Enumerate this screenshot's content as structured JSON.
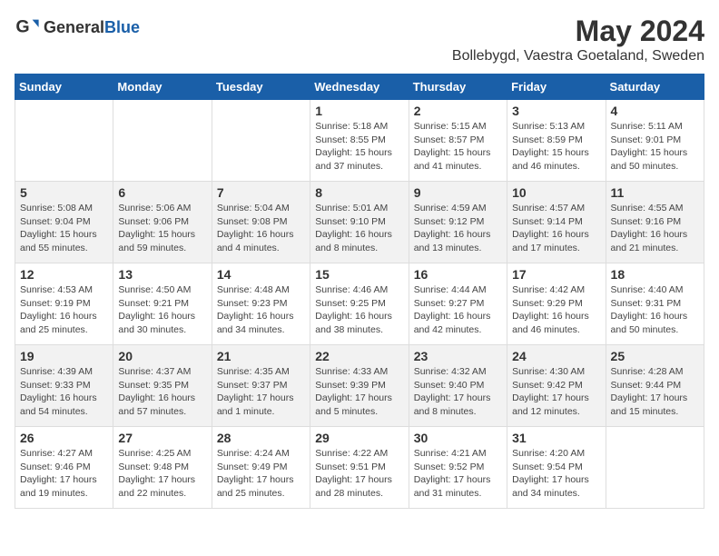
{
  "header": {
    "logo_general": "General",
    "logo_blue": "Blue",
    "main_title": "May 2024",
    "sub_title": "Bollebygd, Vaestra Goetaland, Sweden"
  },
  "calendar": {
    "weekdays": [
      "Sunday",
      "Monday",
      "Tuesday",
      "Wednesday",
      "Thursday",
      "Friday",
      "Saturday"
    ],
    "weeks": [
      [
        {
          "day": "",
          "info": ""
        },
        {
          "day": "",
          "info": ""
        },
        {
          "day": "",
          "info": ""
        },
        {
          "day": "1",
          "info": "Sunrise: 5:18 AM\nSunset: 8:55 PM\nDaylight: 15 hours and 37 minutes."
        },
        {
          "day": "2",
          "info": "Sunrise: 5:15 AM\nSunset: 8:57 PM\nDaylight: 15 hours and 41 minutes."
        },
        {
          "day": "3",
          "info": "Sunrise: 5:13 AM\nSunset: 8:59 PM\nDaylight: 15 hours and 46 minutes."
        },
        {
          "day": "4",
          "info": "Sunrise: 5:11 AM\nSunset: 9:01 PM\nDaylight: 15 hours and 50 minutes."
        }
      ],
      [
        {
          "day": "5",
          "info": "Sunrise: 5:08 AM\nSunset: 9:04 PM\nDaylight: 15 hours and 55 minutes."
        },
        {
          "day": "6",
          "info": "Sunrise: 5:06 AM\nSunset: 9:06 PM\nDaylight: 15 hours and 59 minutes."
        },
        {
          "day": "7",
          "info": "Sunrise: 5:04 AM\nSunset: 9:08 PM\nDaylight: 16 hours and 4 minutes."
        },
        {
          "day": "8",
          "info": "Sunrise: 5:01 AM\nSunset: 9:10 PM\nDaylight: 16 hours and 8 minutes."
        },
        {
          "day": "9",
          "info": "Sunrise: 4:59 AM\nSunset: 9:12 PM\nDaylight: 16 hours and 13 minutes."
        },
        {
          "day": "10",
          "info": "Sunrise: 4:57 AM\nSunset: 9:14 PM\nDaylight: 16 hours and 17 minutes."
        },
        {
          "day": "11",
          "info": "Sunrise: 4:55 AM\nSunset: 9:16 PM\nDaylight: 16 hours and 21 minutes."
        }
      ],
      [
        {
          "day": "12",
          "info": "Sunrise: 4:53 AM\nSunset: 9:19 PM\nDaylight: 16 hours and 25 minutes."
        },
        {
          "day": "13",
          "info": "Sunrise: 4:50 AM\nSunset: 9:21 PM\nDaylight: 16 hours and 30 minutes."
        },
        {
          "day": "14",
          "info": "Sunrise: 4:48 AM\nSunset: 9:23 PM\nDaylight: 16 hours and 34 minutes."
        },
        {
          "day": "15",
          "info": "Sunrise: 4:46 AM\nSunset: 9:25 PM\nDaylight: 16 hours and 38 minutes."
        },
        {
          "day": "16",
          "info": "Sunrise: 4:44 AM\nSunset: 9:27 PM\nDaylight: 16 hours and 42 minutes."
        },
        {
          "day": "17",
          "info": "Sunrise: 4:42 AM\nSunset: 9:29 PM\nDaylight: 16 hours and 46 minutes."
        },
        {
          "day": "18",
          "info": "Sunrise: 4:40 AM\nSunset: 9:31 PM\nDaylight: 16 hours and 50 minutes."
        }
      ],
      [
        {
          "day": "19",
          "info": "Sunrise: 4:39 AM\nSunset: 9:33 PM\nDaylight: 16 hours and 54 minutes."
        },
        {
          "day": "20",
          "info": "Sunrise: 4:37 AM\nSunset: 9:35 PM\nDaylight: 16 hours and 57 minutes."
        },
        {
          "day": "21",
          "info": "Sunrise: 4:35 AM\nSunset: 9:37 PM\nDaylight: 17 hours and 1 minute."
        },
        {
          "day": "22",
          "info": "Sunrise: 4:33 AM\nSunset: 9:39 PM\nDaylight: 17 hours and 5 minutes."
        },
        {
          "day": "23",
          "info": "Sunrise: 4:32 AM\nSunset: 9:40 PM\nDaylight: 17 hours and 8 minutes."
        },
        {
          "day": "24",
          "info": "Sunrise: 4:30 AM\nSunset: 9:42 PM\nDaylight: 17 hours and 12 minutes."
        },
        {
          "day": "25",
          "info": "Sunrise: 4:28 AM\nSunset: 9:44 PM\nDaylight: 17 hours and 15 minutes."
        }
      ],
      [
        {
          "day": "26",
          "info": "Sunrise: 4:27 AM\nSunset: 9:46 PM\nDaylight: 17 hours and 19 minutes."
        },
        {
          "day": "27",
          "info": "Sunrise: 4:25 AM\nSunset: 9:48 PM\nDaylight: 17 hours and 22 minutes."
        },
        {
          "day": "28",
          "info": "Sunrise: 4:24 AM\nSunset: 9:49 PM\nDaylight: 17 hours and 25 minutes."
        },
        {
          "day": "29",
          "info": "Sunrise: 4:22 AM\nSunset: 9:51 PM\nDaylight: 17 hours and 28 minutes."
        },
        {
          "day": "30",
          "info": "Sunrise: 4:21 AM\nSunset: 9:52 PM\nDaylight: 17 hours and 31 minutes."
        },
        {
          "day": "31",
          "info": "Sunrise: 4:20 AM\nSunset: 9:54 PM\nDaylight: 17 hours and 34 minutes."
        },
        {
          "day": "",
          "info": ""
        }
      ]
    ]
  }
}
